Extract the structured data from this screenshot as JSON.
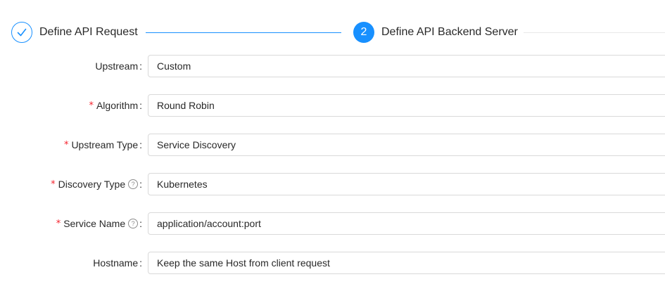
{
  "steps": {
    "step1": {
      "title": "Define API Request",
      "icon": "check-icon"
    },
    "step2": {
      "number": "2",
      "title": "Define API Backend Server"
    }
  },
  "form": {
    "upstream": {
      "label": "Upstream",
      "value": "Custom",
      "required": false
    },
    "algorithm": {
      "label": "Algorithm",
      "value": "Round Robin",
      "required": true
    },
    "upstream_type": {
      "label": "Upstream Type",
      "value": "Service Discovery",
      "required": true
    },
    "discovery_type": {
      "label": "Discovery Type",
      "value": "Kubernetes",
      "required": true,
      "help_icon": "question-circle-icon"
    },
    "service_name": {
      "label": "Service Name",
      "value": "application/account:port",
      "required": true,
      "help_icon": "question-circle-icon"
    },
    "hostname": {
      "label": "Hostname",
      "value": "Keep the same Host from client request",
      "required": false
    }
  },
  "colors": {
    "primary": "#1890ff",
    "required": "#f5222d",
    "border": "#d9d9d9"
  }
}
